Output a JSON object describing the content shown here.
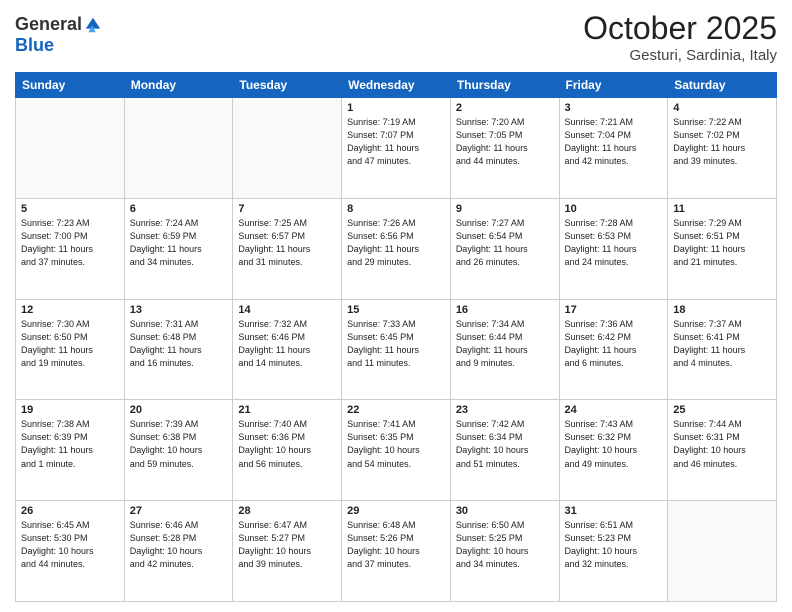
{
  "logo": {
    "general": "General",
    "blue": "Blue"
  },
  "header": {
    "month": "October 2025",
    "location": "Gesturi, Sardinia, Italy"
  },
  "days_of_week": [
    "Sunday",
    "Monday",
    "Tuesday",
    "Wednesday",
    "Thursday",
    "Friday",
    "Saturday"
  ],
  "weeks": [
    [
      {
        "day": "",
        "info": ""
      },
      {
        "day": "",
        "info": ""
      },
      {
        "day": "",
        "info": ""
      },
      {
        "day": "1",
        "info": "Sunrise: 7:19 AM\nSunset: 7:07 PM\nDaylight: 11 hours\nand 47 minutes."
      },
      {
        "day": "2",
        "info": "Sunrise: 7:20 AM\nSunset: 7:05 PM\nDaylight: 11 hours\nand 44 minutes."
      },
      {
        "day": "3",
        "info": "Sunrise: 7:21 AM\nSunset: 7:04 PM\nDaylight: 11 hours\nand 42 minutes."
      },
      {
        "day": "4",
        "info": "Sunrise: 7:22 AM\nSunset: 7:02 PM\nDaylight: 11 hours\nand 39 minutes."
      }
    ],
    [
      {
        "day": "5",
        "info": "Sunrise: 7:23 AM\nSunset: 7:00 PM\nDaylight: 11 hours\nand 37 minutes."
      },
      {
        "day": "6",
        "info": "Sunrise: 7:24 AM\nSunset: 6:59 PM\nDaylight: 11 hours\nand 34 minutes."
      },
      {
        "day": "7",
        "info": "Sunrise: 7:25 AM\nSunset: 6:57 PM\nDaylight: 11 hours\nand 31 minutes."
      },
      {
        "day": "8",
        "info": "Sunrise: 7:26 AM\nSunset: 6:56 PM\nDaylight: 11 hours\nand 29 minutes."
      },
      {
        "day": "9",
        "info": "Sunrise: 7:27 AM\nSunset: 6:54 PM\nDaylight: 11 hours\nand 26 minutes."
      },
      {
        "day": "10",
        "info": "Sunrise: 7:28 AM\nSunset: 6:53 PM\nDaylight: 11 hours\nand 24 minutes."
      },
      {
        "day": "11",
        "info": "Sunrise: 7:29 AM\nSunset: 6:51 PM\nDaylight: 11 hours\nand 21 minutes."
      }
    ],
    [
      {
        "day": "12",
        "info": "Sunrise: 7:30 AM\nSunset: 6:50 PM\nDaylight: 11 hours\nand 19 minutes."
      },
      {
        "day": "13",
        "info": "Sunrise: 7:31 AM\nSunset: 6:48 PM\nDaylight: 11 hours\nand 16 minutes."
      },
      {
        "day": "14",
        "info": "Sunrise: 7:32 AM\nSunset: 6:46 PM\nDaylight: 11 hours\nand 14 minutes."
      },
      {
        "day": "15",
        "info": "Sunrise: 7:33 AM\nSunset: 6:45 PM\nDaylight: 11 hours\nand 11 minutes."
      },
      {
        "day": "16",
        "info": "Sunrise: 7:34 AM\nSunset: 6:44 PM\nDaylight: 11 hours\nand 9 minutes."
      },
      {
        "day": "17",
        "info": "Sunrise: 7:36 AM\nSunset: 6:42 PM\nDaylight: 11 hours\nand 6 minutes."
      },
      {
        "day": "18",
        "info": "Sunrise: 7:37 AM\nSunset: 6:41 PM\nDaylight: 11 hours\nand 4 minutes."
      }
    ],
    [
      {
        "day": "19",
        "info": "Sunrise: 7:38 AM\nSunset: 6:39 PM\nDaylight: 11 hours\nand 1 minute."
      },
      {
        "day": "20",
        "info": "Sunrise: 7:39 AM\nSunset: 6:38 PM\nDaylight: 10 hours\nand 59 minutes."
      },
      {
        "day": "21",
        "info": "Sunrise: 7:40 AM\nSunset: 6:36 PM\nDaylight: 10 hours\nand 56 minutes."
      },
      {
        "day": "22",
        "info": "Sunrise: 7:41 AM\nSunset: 6:35 PM\nDaylight: 10 hours\nand 54 minutes."
      },
      {
        "day": "23",
        "info": "Sunrise: 7:42 AM\nSunset: 6:34 PM\nDaylight: 10 hours\nand 51 minutes."
      },
      {
        "day": "24",
        "info": "Sunrise: 7:43 AM\nSunset: 6:32 PM\nDaylight: 10 hours\nand 49 minutes."
      },
      {
        "day": "25",
        "info": "Sunrise: 7:44 AM\nSunset: 6:31 PM\nDaylight: 10 hours\nand 46 minutes."
      }
    ],
    [
      {
        "day": "26",
        "info": "Sunrise: 6:45 AM\nSunset: 5:30 PM\nDaylight: 10 hours\nand 44 minutes."
      },
      {
        "day": "27",
        "info": "Sunrise: 6:46 AM\nSunset: 5:28 PM\nDaylight: 10 hours\nand 42 minutes."
      },
      {
        "day": "28",
        "info": "Sunrise: 6:47 AM\nSunset: 5:27 PM\nDaylight: 10 hours\nand 39 minutes."
      },
      {
        "day": "29",
        "info": "Sunrise: 6:48 AM\nSunset: 5:26 PM\nDaylight: 10 hours\nand 37 minutes."
      },
      {
        "day": "30",
        "info": "Sunrise: 6:50 AM\nSunset: 5:25 PM\nDaylight: 10 hours\nand 34 minutes."
      },
      {
        "day": "31",
        "info": "Sunrise: 6:51 AM\nSunset: 5:23 PM\nDaylight: 10 hours\nand 32 minutes."
      },
      {
        "day": "",
        "info": ""
      }
    ]
  ]
}
